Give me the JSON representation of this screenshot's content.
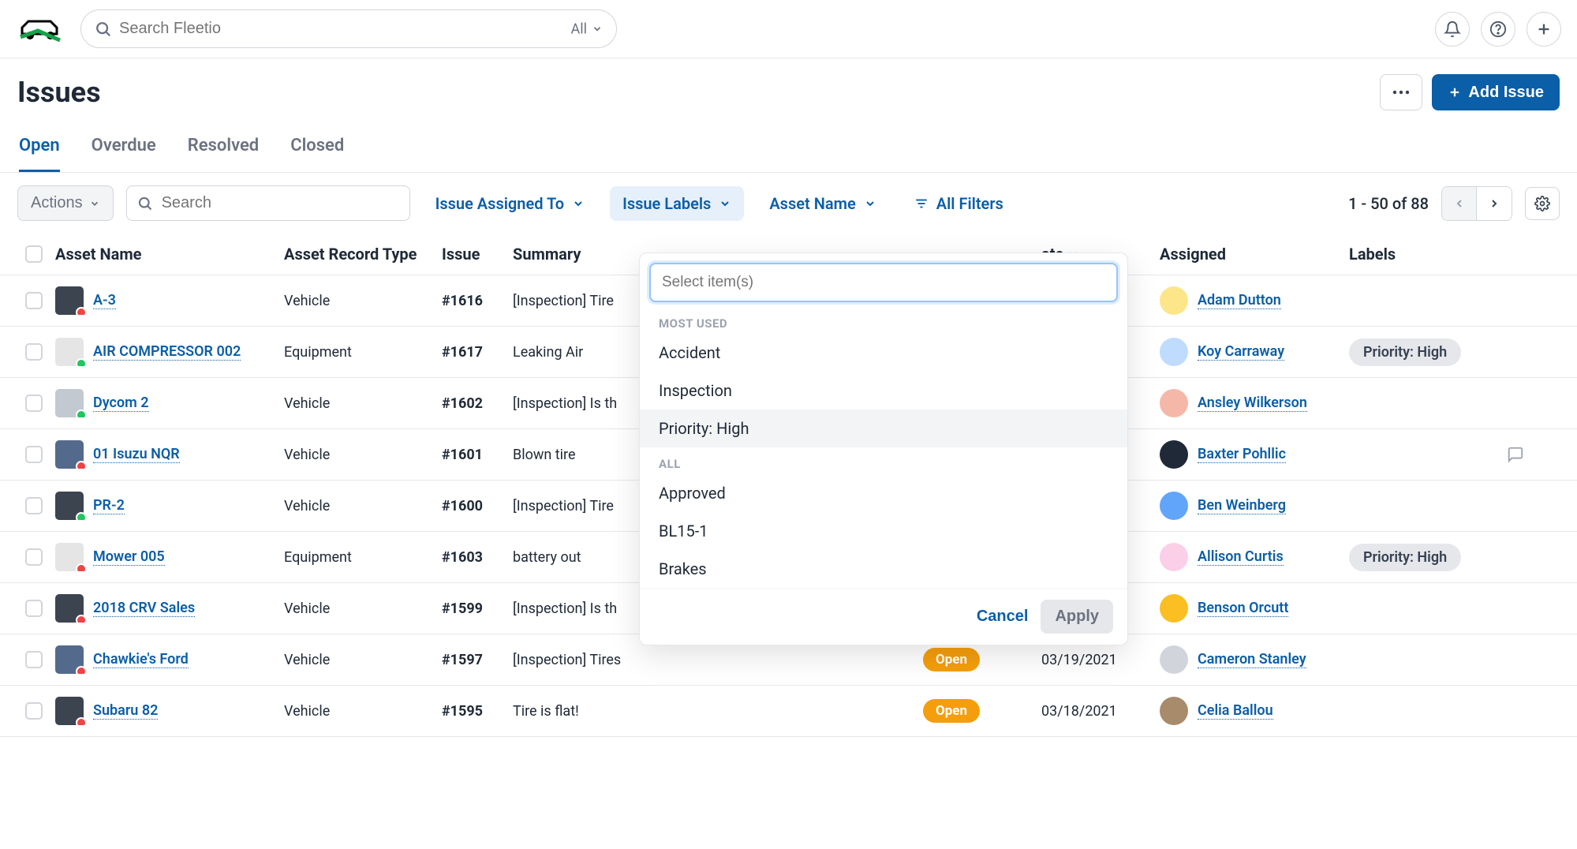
{
  "header": {
    "search_placeholder": "Search Fleetio",
    "all_label": "All"
  },
  "page": {
    "title": "Issues",
    "add_button": "Add Issue"
  },
  "tabs": [
    "Open",
    "Overdue",
    "Resolved",
    "Closed"
  ],
  "toolbar": {
    "actions_label": "Actions",
    "search_placeholder": "Search",
    "filters": {
      "assigned": "Issue Assigned To",
      "labels": "Issue Labels",
      "asset_name": "Asset Name",
      "all_filters": "All Filters"
    },
    "pagination": "1 - 50 of 88"
  },
  "columns": {
    "asset_name": "Asset Name",
    "asset_record_type": "Asset Record Type",
    "issue": "Issue",
    "summary": "Summary",
    "status": "",
    "date": "ate",
    "assigned": "Assigned",
    "labels": "Labels"
  },
  "dropdown": {
    "placeholder": "Select item(s)",
    "section_most": "MOST USED",
    "section_all": "ALL",
    "most_used": [
      "Accident",
      "Inspection",
      "Priority: High"
    ],
    "all_items": [
      "Approved",
      "BL15-1",
      "Brakes"
    ],
    "cancel": "Cancel",
    "apply": "Apply"
  },
  "rows": [
    {
      "asset": "A-3",
      "type": "Vehicle",
      "issue": "#1616",
      "summary": "[Inspection] Tire",
      "status": "",
      "date": "",
      "assigned": "Adam Dutton",
      "label": "",
      "dot": "red",
      "thumb": "dark",
      "avatar": "c0",
      "comment": false
    },
    {
      "asset": "AIR COMPRESSOR 002",
      "type": "Equipment",
      "issue": "#1617",
      "summary": "Leaking Air",
      "status": "",
      "date": "",
      "assigned": "Koy Carraway",
      "label": "Priority: High",
      "dot": "green",
      "thumb": "eq",
      "avatar": "c1",
      "comment": false
    },
    {
      "asset": "Dycom 2",
      "type": "Vehicle",
      "issue": "#1602",
      "summary": "[Inspection] Is th",
      "status": "",
      "date": "",
      "assigned": "Ansley Wilkerson",
      "label": "",
      "dot": "green",
      "thumb": "light",
      "avatar": "c2",
      "comment": false
    },
    {
      "asset": "01 Isuzu NQR",
      "type": "Vehicle",
      "issue": "#1601",
      "summary": "Blown tire",
      "status": "",
      "date": "",
      "assigned": "Baxter Pohllic",
      "label": "",
      "dot": "red",
      "thumb": "blue",
      "avatar": "c3",
      "comment": true
    },
    {
      "asset": "PR-2",
      "type": "Vehicle",
      "issue": "#1600",
      "summary": "[Inspection] Tire",
      "status": "",
      "date": "",
      "assigned": "Ben Weinberg",
      "label": "",
      "dot": "green",
      "thumb": "dark",
      "avatar": "c4",
      "comment": false
    },
    {
      "asset": "Mower 005",
      "type": "Equipment",
      "issue": "#1603",
      "summary": "battery out",
      "status": "",
      "date": "",
      "assigned": "Allison Curtis",
      "label": "Priority: High",
      "dot": "red",
      "thumb": "eq",
      "avatar": "c5",
      "comment": false
    },
    {
      "asset": "2018 CRV Sales",
      "type": "Vehicle",
      "issue": "#1599",
      "summary": "[Inspection] Is th",
      "status": "",
      "date": "",
      "assigned": "Benson Orcutt",
      "label": "",
      "dot": "red",
      "thumb": "dark",
      "avatar": "c6",
      "comment": false
    },
    {
      "asset": "Chawkie's Ford",
      "type": "Vehicle",
      "issue": "#1597",
      "summary": "[Inspection] Tires",
      "status": "Open",
      "date": "03/19/2021",
      "assigned": "Cameron Stanley",
      "label": "",
      "dot": "red",
      "thumb": "blue",
      "avatar": "c7",
      "comment": false
    },
    {
      "asset": "Subaru 82",
      "type": "Vehicle",
      "issue": "#1595",
      "summary": "Tire is flat!",
      "status": "Open",
      "date": "03/18/2021",
      "assigned": "Celia Ballou",
      "label": "",
      "dot": "red",
      "thumb": "dark",
      "avatar": "c8",
      "comment": false
    }
  ]
}
